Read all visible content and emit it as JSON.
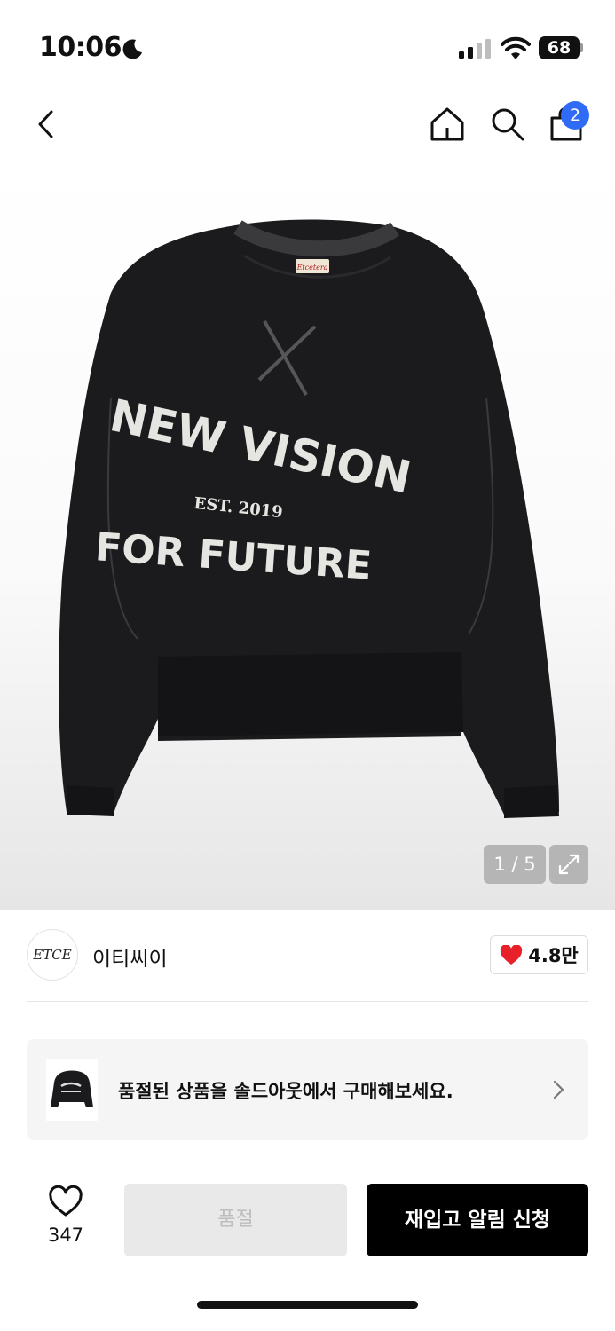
{
  "status_bar": {
    "time": "10:06",
    "battery": "68",
    "icons": [
      "moon-icon",
      "signal-icon",
      "wifi-icon",
      "battery-icon"
    ]
  },
  "nav": {
    "cart_badge": "2",
    "icons": [
      "back-icon",
      "home-icon",
      "search-icon",
      "shopping-bag-icon"
    ]
  },
  "gallery": {
    "page_indicator": "1 / 5",
    "print_line1": "NEW VISION",
    "print_est": "EST. 2019",
    "print_line2": "FOR FUTURE",
    "label_tag": "Etcetera",
    "icons": [
      "expand-icon"
    ]
  },
  "brand": {
    "logo_text": "ETCE",
    "name": "이티씨이",
    "likes": "4.8만",
    "icons": [
      "heart-filled-icon"
    ]
  },
  "colors": {
    "accent": "#2f6bf5",
    "heart": "#e8202a",
    "primary_button": "#000000",
    "disabled_button": "#e9e9e9"
  },
  "soldout_banner": {
    "text": "품절된 상품을 솔드아웃에서 구매해보세요.",
    "icons": [
      "chevron-right-icon"
    ]
  },
  "bottom_bar": {
    "wish_count": "347",
    "soldout_label": "품절",
    "restock_label": "재입고 알림 신청",
    "icons": [
      "heart-outline-icon"
    ]
  }
}
